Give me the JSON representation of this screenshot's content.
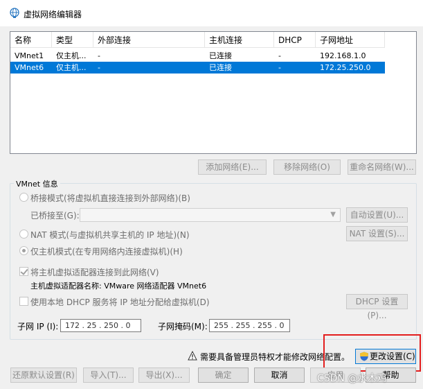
{
  "window": {
    "title": "虚拟网络编辑器",
    "icon": "globe-network-icon"
  },
  "table": {
    "headers": [
      "名称",
      "类型",
      "外部连接",
      "主机连接",
      "DHCP",
      "子网地址"
    ],
    "rows": [
      {
        "name": "VMnet1",
        "type": "仅主机...",
        "external": "-",
        "host": "已连接",
        "dhcp": "-",
        "subnet": "192.168.1.0",
        "selected": false
      },
      {
        "name": "VMnet6",
        "type": "仅主机...",
        "external": "-",
        "host": "已连接",
        "dhcp": "-",
        "subnet": "172.25.250.0",
        "selected": true
      }
    ]
  },
  "list_buttons": {
    "add": "添加网络(E)...",
    "remove": "移除网络(O)",
    "rename": "重命名网络(W)..."
  },
  "vmnet_info": {
    "title": "VMnet 信息",
    "bridge_mode": "桥接模式(将虚拟机直接连接到外部网络)(B)",
    "bridged_to_label": "已桥接至(G):",
    "bridged_to_value": "",
    "auto_settings": "自动设置(U)...",
    "nat_mode": "NAT 模式(与虚拟机共享主机的 IP 地址)(N)",
    "nat_settings": "NAT 设置(S)...",
    "host_only_mode": "仅主机模式(在专用网络内连接虚拟机)(H)",
    "connect_adapter": "将主机虚拟适配器连接到此网络(V)",
    "adapter_name": "主机虚拟适配器名称: VMware 网络适配器 VMnet6",
    "use_dhcp": "使用本地 DHCP 服务将 IP 地址分配给虚拟机(D)",
    "dhcp_settings": "DHCP 设置(P)...",
    "subnet_ip_label": "子网 IP (I):",
    "subnet_ip_value": "172 . 25 . 250 . 0",
    "subnet_mask_label": "子网掩码(M):",
    "subnet_mask_value": "255 . 255 . 255 . 0",
    "mode_selected": "host-only",
    "connect_adapter_checked": true,
    "use_dhcp_checked": false
  },
  "admin": {
    "warning": "需要具备管理员特权才能修改网络配置。",
    "change_settings": "更改设置(C)"
  },
  "footer": {
    "restore": "还原默认设置(R)",
    "import": "导入(T)...",
    "export": "导出(X)...",
    "ok": "确定",
    "cancel": "取消",
    "apply": "应用",
    "help": "帮助"
  },
  "watermark": "CSDN @水木鸡",
  "colors": {
    "selection": "#0078d7",
    "highlight_box": "#e31d1d"
  }
}
